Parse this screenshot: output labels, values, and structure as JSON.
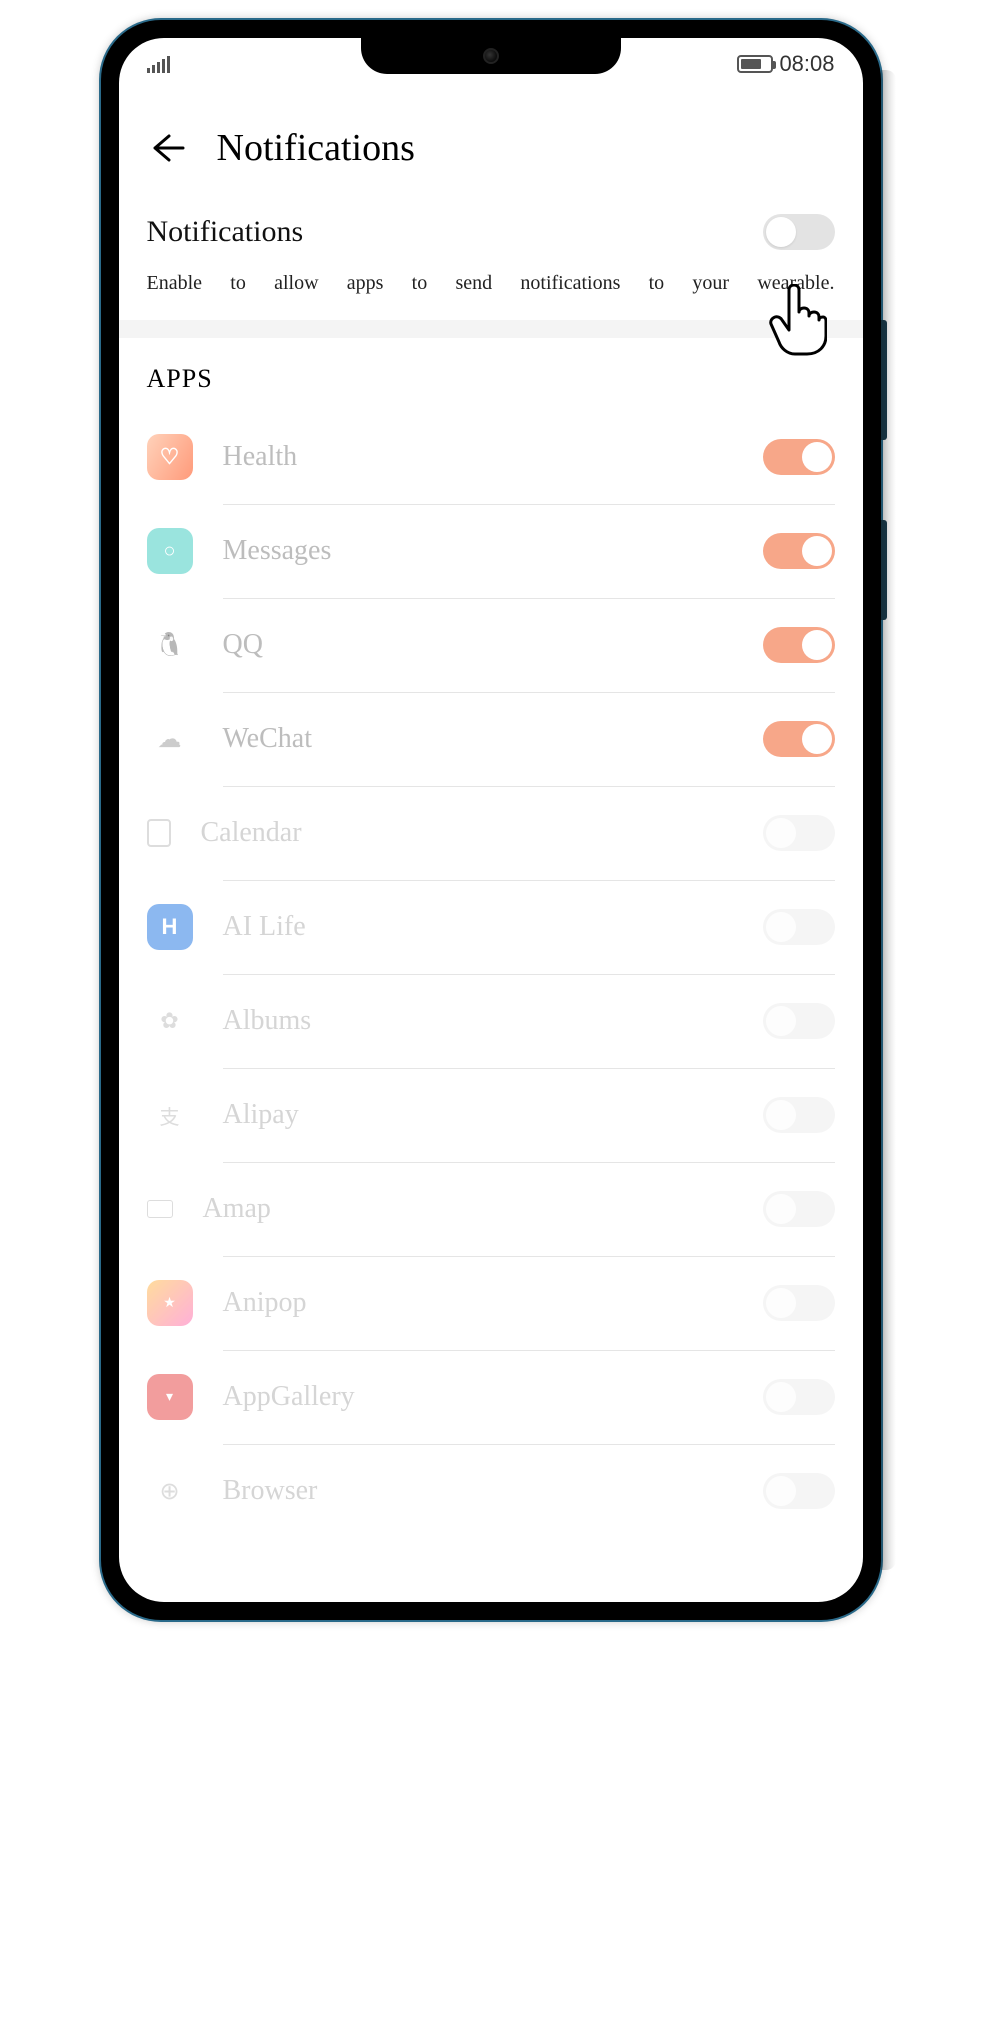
{
  "status_bar": {
    "time": "08:08"
  },
  "header": {
    "title": "Notifications"
  },
  "master": {
    "label": "Notifications",
    "description": "Enable to allow apps to send notifications to your wearable.",
    "enabled": false
  },
  "section_title": "APPS",
  "apps": [
    {
      "name": "Health",
      "icon": "health",
      "enabled": true,
      "faded": false
    },
    {
      "name": "Messages",
      "icon": "messages",
      "enabled": true,
      "faded": false
    },
    {
      "name": "QQ",
      "icon": "qq",
      "enabled": true,
      "faded": false
    },
    {
      "name": "WeChat",
      "icon": "wechat",
      "enabled": true,
      "faded": false
    },
    {
      "name": "Calendar",
      "icon": "calendar",
      "enabled": false,
      "faded": true
    },
    {
      "name": "AI Life",
      "icon": "ailife",
      "enabled": false,
      "faded": true
    },
    {
      "name": "Albums",
      "icon": "albums",
      "enabled": false,
      "faded": true
    },
    {
      "name": "Alipay",
      "icon": "alipay",
      "enabled": false,
      "faded": true
    },
    {
      "name": "Amap",
      "icon": "amap",
      "enabled": false,
      "faded": true
    },
    {
      "name": "Anipop",
      "icon": "anipop",
      "enabled": false,
      "faded": true
    },
    {
      "name": "AppGallery",
      "icon": "appgallery",
      "enabled": false,
      "faded": true
    },
    {
      "name": "Browser",
      "icon": "browser",
      "enabled": false,
      "faded": true
    }
  ]
}
